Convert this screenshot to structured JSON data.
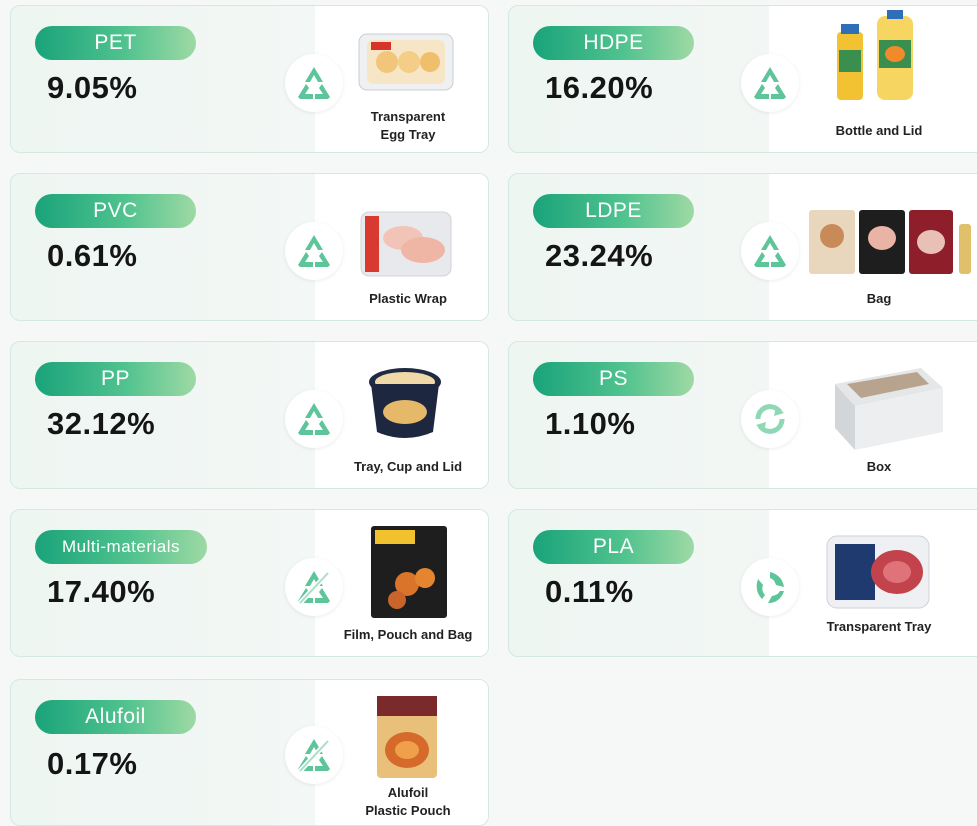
{
  "colors": {
    "accent_start": "#1aa37a",
    "accent_end": "#9ed9a4",
    "icon": "#5ec49a"
  },
  "cards": [
    {
      "material": "PET",
      "percent": "9.05%",
      "caption1": "Transparent",
      "caption2": "Egg Tray",
      "icon": "recycle-triangle-icon"
    },
    {
      "material": "HDPE",
      "percent": "16.20%",
      "caption1": "Bottle and Lid",
      "caption2": "",
      "icon": "recycle-triangle-icon"
    },
    {
      "material": "PVC",
      "percent": "0.61%",
      "caption1": "Plastic Wrap",
      "caption2": "",
      "icon": "recycle-triangle-icon"
    },
    {
      "material": "LDPE",
      "percent": "23.24%",
      "caption1": "Bag",
      "caption2": "",
      "icon": "recycle-triangle-icon"
    },
    {
      "material": "PP",
      "percent": "32.12%",
      "caption1": "Tray, Cup and Lid",
      "caption2": "",
      "icon": "recycle-triangle-icon"
    },
    {
      "material": "PS",
      "percent": "1.10%",
      "caption1": "Box",
      "caption2": "",
      "icon": "rotate-arrows-icon"
    },
    {
      "material": "Multi-materials",
      "percent": "17.40%",
      "caption1": "Film, Pouch and Bag",
      "caption2": "",
      "icon": "non-recyclable-icon"
    },
    {
      "material": "PLA",
      "percent": "0.11%",
      "caption1": "Transparent Tray",
      "caption2": "",
      "icon": "compost-icon"
    },
    {
      "material": "Alufoil",
      "percent": "0.17%",
      "caption1": "Alufoil",
      "caption2": "Plastic Pouch",
      "icon": "non-recyclable-icon"
    }
  ]
}
